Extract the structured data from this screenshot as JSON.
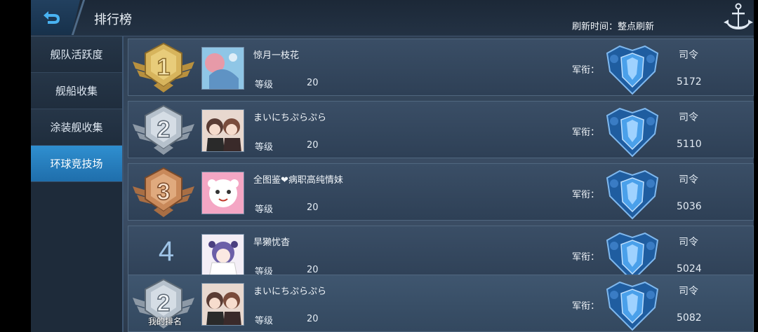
{
  "header": {
    "title": "排行榜",
    "refresh_text": "刷新时间：整点刷新"
  },
  "sidebar": {
    "items": [
      {
        "label": "舰队活跃度",
        "active": false
      },
      {
        "label": "舰船收集",
        "active": false
      },
      {
        "label": "涂装舰收集",
        "active": false
      },
      {
        "label": "环球竞技场",
        "active": true
      }
    ]
  },
  "rows": [
    {
      "rank": "1",
      "medal": "gold",
      "name": "惊月一枝花",
      "level_label": "等级",
      "level": "20",
      "rank_label": "军衔：",
      "title": "司令",
      "score": "5172"
    },
    {
      "rank": "2",
      "medal": "silver",
      "name": "まいにちぷらぷら",
      "level_label": "等级",
      "level": "20",
      "rank_label": "军衔：",
      "title": "司令",
      "score": "5110"
    },
    {
      "rank": "3",
      "medal": "bronze",
      "name": "全图鉴❤病职高纯情妹",
      "level_label": "等级",
      "level": "20",
      "rank_label": "军衔：",
      "title": "司令",
      "score": "5036"
    },
    {
      "rank": "4",
      "medal": "none",
      "name": "旱獭忧杳",
      "level_label": "等级",
      "level": "20",
      "rank_label": "军衔：",
      "title": "司令",
      "score": "5024"
    }
  ],
  "my_rank": {
    "label": "我的排名",
    "rank": "2",
    "medal": "silver",
    "name": "まいにちぷらぷら",
    "level_label": "等级",
    "level": "20",
    "rank_label": "军衔：",
    "title": "司令",
    "score": "5082"
  },
  "icons": {
    "back": "back-arrow-icon",
    "logo": "anchor-icon",
    "crest": "commander-crest-icon"
  },
  "colors": {
    "accent": "#2f8fd0",
    "gold": "#c9a24a",
    "silver": "#aab6c2",
    "bronze": "#c9895a"
  }
}
